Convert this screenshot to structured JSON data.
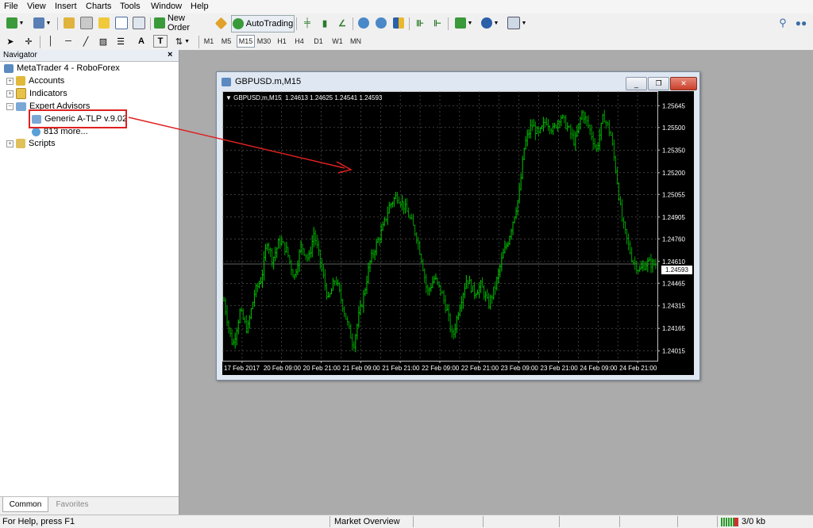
{
  "menu": [
    "File",
    "View",
    "Insert",
    "Charts",
    "Tools",
    "Window",
    "Help"
  ],
  "toolbar": {
    "new_order": "New Order",
    "auto_trading": "AutoTrading",
    "timeframes": [
      "M1",
      "M5",
      "M15",
      "M30",
      "H1",
      "H4",
      "D1",
      "W1",
      "MN"
    ],
    "active_timeframe": "M15",
    "text_tool": "A",
    "textlabel_tool": "T"
  },
  "navigator": {
    "title": "Navigator",
    "close": "×",
    "root": "MetaTrader 4 - RoboForex",
    "items": [
      {
        "label": "Accounts"
      },
      {
        "label": "Indicators"
      },
      {
        "label": "Expert Advisors"
      },
      {
        "label": "Generic A-TLP v.9.02"
      },
      {
        "label": "813 more..."
      },
      {
        "label": "Scripts"
      }
    ],
    "tabs": [
      "Common",
      "Favorites"
    ]
  },
  "chart_window": {
    "title": "GBPUSD.m,M15",
    "info": "GBPUSD.m,M15  1.24613 1.24625 1.24541 1.24593",
    "current_price": "1.24593",
    "minimize": "_",
    "restore": "❐",
    "close": "✕"
  },
  "chart_data": {
    "type": "bar",
    "symbol": "GBPUSD.m",
    "timeframe": "M15",
    "ylim": [
      1.2395,
      1.2571
    ],
    "y_ticks": [
      "1.25645",
      "1.25500",
      "1.25350",
      "1.25200",
      "1.25055",
      "1.24905",
      "1.24760",
      "1.24610",
      "1.24465",
      "1.24315",
      "1.24165",
      "1.24015"
    ],
    "x_ticks": [
      "17 Feb 2017",
      "20 Feb 09:00",
      "20 Feb 21:00",
      "21 Feb 09:00",
      "21 Feb 21:00",
      "22 Feb 09:00",
      "22 Feb 21:00",
      "23 Feb 09:00",
      "23 Feb 21:00",
      "24 Feb 09:00",
      "24 Feb 21:00"
    ],
    "last_price": 1.24593,
    "ohlc_last": {
      "open": 1.24613,
      "high": 1.24625,
      "low": 1.24541,
      "close": 1.24593
    },
    "path": [
      [
        0,
        1.2435
      ],
      [
        3,
        1.2415
      ],
      [
        5,
        1.2405
      ],
      [
        9,
        1.2428
      ],
      [
        13,
        1.2415
      ],
      [
        17,
        1.244
      ],
      [
        21,
        1.245
      ],
      [
        24,
        1.2475
      ],
      [
        27,
        1.2462
      ],
      [
        31,
        1.2475
      ],
      [
        35,
        1.2468
      ],
      [
        39,
        1.245
      ],
      [
        43,
        1.2472
      ],
      [
        47,
        1.2462
      ],
      [
        50,
        1.248
      ],
      [
        54,
        1.2458
      ],
      [
        58,
        1.2435
      ],
      [
        62,
        1.245
      ],
      [
        66,
        1.2432
      ],
      [
        69,
        1.2418
      ],
      [
        72,
        1.2405
      ],
      [
        75,
        1.2425
      ],
      [
        78,
        1.244
      ],
      [
        81,
        1.246
      ],
      [
        84,
        1.247
      ],
      [
        88,
        1.2482
      ],
      [
        92,
        1.2498
      ],
      [
        96,
        1.2505
      ],
      [
        100,
        1.2498
      ],
      [
        104,
        1.2488
      ],
      [
        107,
        1.2478
      ],
      [
        110,
        1.2462
      ],
      [
        113,
        1.244
      ],
      [
        117,
        1.245
      ],
      [
        121,
        1.244
      ],
      [
        124,
        1.2428
      ],
      [
        127,
        1.241
      ],
      [
        131,
        1.2432
      ],
      [
        135,
        1.245
      ],
      [
        139,
        1.244
      ],
      [
        143,
        1.2445
      ],
      [
        147,
        1.2432
      ],
      [
        151,
        1.2445
      ],
      [
        155,
        1.2465
      ],
      [
        158,
        1.2475
      ],
      [
        161,
        1.249
      ],
      [
        164,
        1.2505
      ],
      [
        167,
        1.2538
      ],
      [
        171,
        1.2552
      ],
      [
        175,
        1.2545
      ],
      [
        179,
        1.2555
      ],
      [
        183,
        1.2548
      ],
      [
        187,
        1.2558
      ],
      [
        191,
        1.255
      ],
      [
        195,
        1.254
      ],
      [
        199,
        1.256
      ],
      [
        203,
        1.255
      ],
      [
        207,
        1.2535
      ],
      [
        211,
        1.2558
      ],
      [
        215,
        1.2545
      ],
      [
        218,
        1.252
      ],
      [
        221,
        1.249
      ],
      [
        224,
        1.2475
      ],
      [
        227,
        1.2462
      ],
      [
        231,
        1.2455
      ],
      [
        235,
        1.246
      ],
      [
        240,
        1.2459
      ]
    ],
    "path_x_range": [
      0,
      240
    ],
    "colors": {
      "bull": "#00c800",
      "bear": "#00a000",
      "grid": "#606060",
      "background": "#000000",
      "axis_text": "#ffffff"
    }
  },
  "status": {
    "help": "For Help, press F1",
    "market": "Market Overview",
    "traffic": "3/0 kb"
  }
}
